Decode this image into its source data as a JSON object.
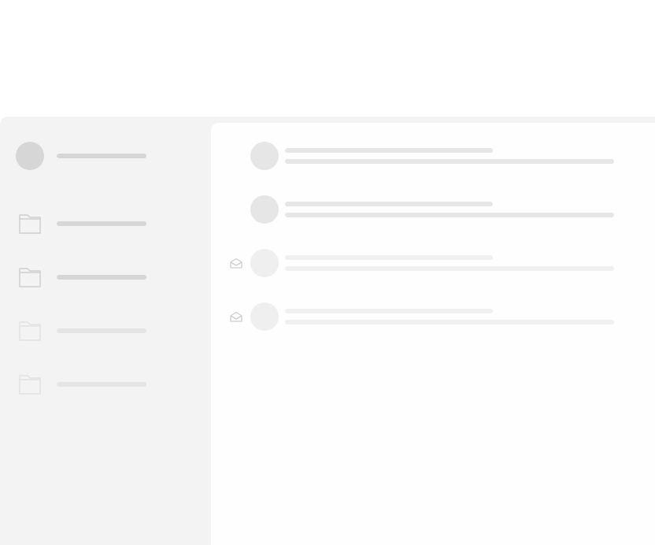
{
  "theme": {
    "page_bg": "#ffffff",
    "frame_bg": "#f3f3f3",
    "content_bg": "#fefefe",
    "skeleton_dark": "#d6d6d6",
    "skeleton_mid": "#e6e6e6",
    "skeleton_light": "#efefef"
  },
  "sidebar": {
    "account": {
      "icon": "avatar-placeholder"
    },
    "folders": [
      {
        "icon": "folder-icon",
        "state": "loaded"
      },
      {
        "icon": "folder-icon",
        "state": "loaded"
      },
      {
        "icon": "folder-icon",
        "state": "faded"
      },
      {
        "icon": "folder-icon",
        "state": "faded"
      }
    ]
  },
  "message_list": {
    "rows": [
      {
        "icon": null,
        "state": "loaded"
      },
      {
        "icon": null,
        "state": "loaded"
      },
      {
        "icon": "mail-open-icon",
        "state": "faded"
      },
      {
        "icon": "mail-open-icon",
        "state": "faded"
      }
    ]
  }
}
